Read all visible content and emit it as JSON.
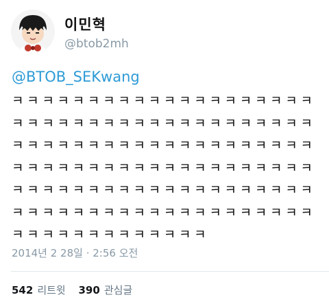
{
  "user": {
    "display_name": "이민혁",
    "handle": "@btob2mh"
  },
  "tweet": {
    "mention": "@BTOB_SEKwang",
    "lines": [
      "ㅋㅋㅋㅋㅋㅋㅋㅋㅋㅋㅋㅋㅋㅋㅋㅋㅋㅋㅋㅋ",
      "ㅋㅋㅋㅋㅋㅋㅋㅋㅋㅋㅋㅋㅋㅋㅋㅋㅋㅋㅋㅋ",
      "ㅋㅋㅋㅋㅋㅋㅋㅋㅋㅋㅋㅋㅋㅋㅋㅋㅋㅋㅋㅋ",
      "ㅋㅋㅋㅋㅋㅋㅋㅋㅋㅋㅋㅋㅋㅋㅋㅋㅋㅋㅋㅋ",
      "ㅋㅋㅋㅋㅋㅋㅋㅋㅋㅋㅋㅋㅋㅋㅋㅋㅋㅋㅋㅋ",
      "ㅋㅋㅋㅋㅋㅋㅋㅋㅋㅋㅋㅋㅋㅋㅋㅋㅋㅋㅋㅋ",
      "ㅋㅋㅋㅋㅋㅋㅋㅋㅋㅋㅋㅋㅋ"
    ],
    "timestamp": "2014년 2 28일 · 2:56 오전"
  },
  "stats": {
    "retweets": {
      "count": "542",
      "label": "리트윗"
    },
    "likes": {
      "count": "390",
      "label": "관심글"
    }
  },
  "colors": {
    "link": "#2d9bd6",
    "muted": "#8899a6",
    "divider": "#e1e8ed"
  }
}
